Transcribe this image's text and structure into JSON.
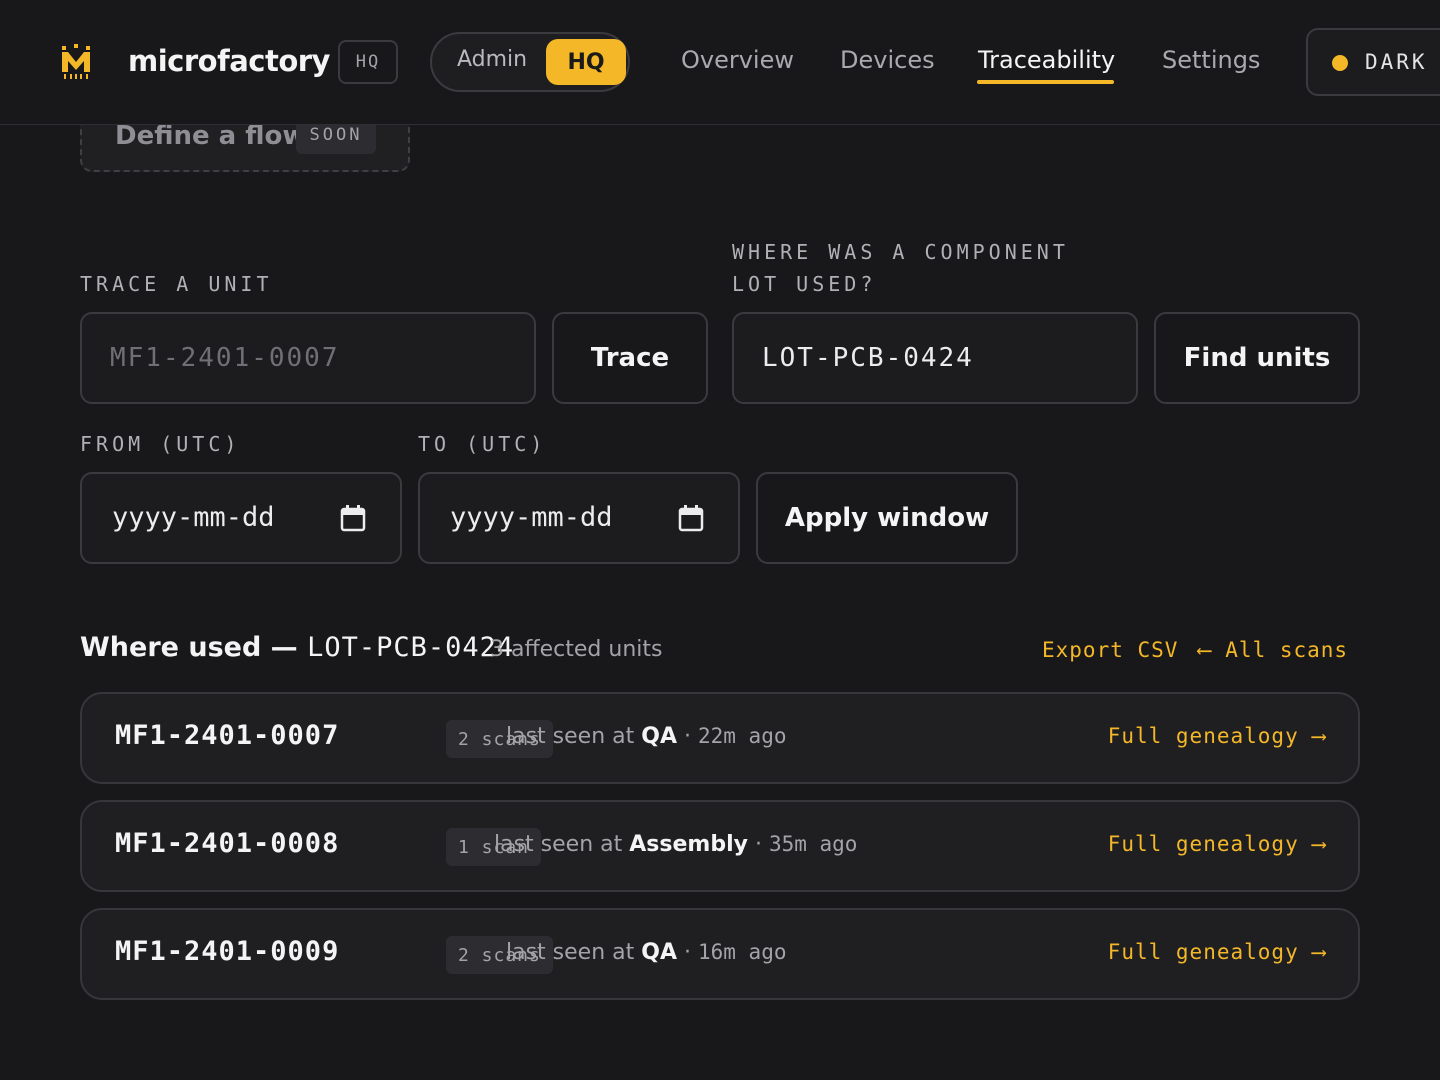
{
  "header": {
    "brand": "microfactory",
    "brand_tag": "HQ",
    "mode_switch": {
      "admin": "Admin",
      "hq": "HQ",
      "selected": "HQ"
    },
    "nav": [
      {
        "label": "Overview"
      },
      {
        "label": "Devices"
      },
      {
        "label": "Traceability",
        "active": true
      },
      {
        "label": "Settings"
      }
    ],
    "theme_label": "DARK"
  },
  "flow_card": {
    "title": "Define a flow",
    "badge": "SOON"
  },
  "trace_unit": {
    "label": "TRACE A UNIT",
    "placeholder": "MF1-2401-0007",
    "value": "",
    "button": "Trace"
  },
  "component_lot": {
    "label": "WHERE WAS A COMPONENT LOT USED?",
    "value": "LOT-PCB-0424",
    "button": "Find units"
  },
  "window": {
    "from_label": "FROM (UTC)",
    "to_label": "TO (UTC)",
    "from_value": "yyyy-mm-dd",
    "to_value": "yyyy-mm-dd",
    "button": "Apply window"
  },
  "results": {
    "title_prefix": "Where used —",
    "lot": "LOT-PCB-0424",
    "count": "3 affected units",
    "export": "Export CSV",
    "back": "⟵ All scans",
    "rows": [
      {
        "id": "MF1-2401-0007",
        "scans": "2 scans",
        "seen_prefix": "last seen at",
        "station": "QA",
        "ago": "22m ago",
        "link": "Full genealogy ⟶"
      },
      {
        "id": "MF1-2401-0008",
        "scans": "1 scan",
        "seen_prefix": "last seen at",
        "station": "Assembly",
        "ago": "35m ago",
        "link": "Full genealogy ⟶"
      },
      {
        "id": "MF1-2401-0009",
        "scans": "2 scans",
        "seen_prefix": "last seen at",
        "station": "QA",
        "ago": "16m ago",
        "link": "Full genealogy ⟶"
      }
    ]
  },
  "colors": {
    "accent": "#f4b728",
    "background": "#18181a",
    "surface": "#1f1f22",
    "border": "#3a3a3f"
  }
}
